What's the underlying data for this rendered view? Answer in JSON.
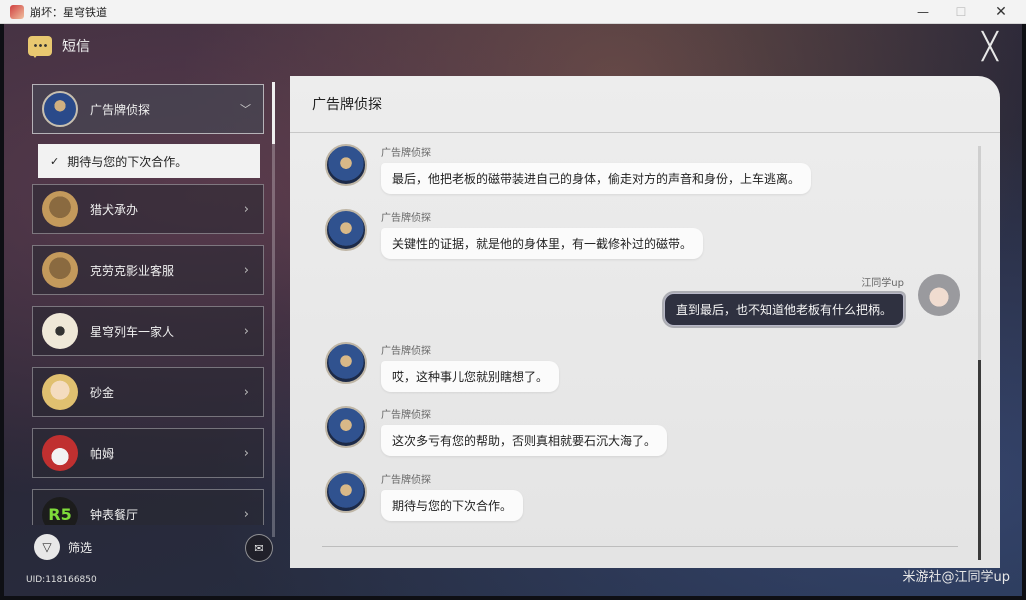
{
  "window": {
    "title": "崩坏：星穹铁道",
    "minimize": "—",
    "maximize": "☐",
    "close": "✕"
  },
  "header": {
    "title": "短信",
    "close_glyph": "╳"
  },
  "sidebar": {
    "contacts": [
      {
        "name": "广告牌侦探",
        "expanded": true
      },
      {
        "name": "猎犬承办"
      },
      {
        "name": "克劳克影业客服"
      },
      {
        "name": "星穹列车一家人"
      },
      {
        "name": "砂金"
      },
      {
        "name": "帕姆"
      },
      {
        "name": "钟表餐厅"
      }
    ],
    "sub_item": "期待与您的下次合作。",
    "filter_label": "筛选",
    "uid": "UID:118166850",
    "avatar_text_r5": "R5"
  },
  "chat": {
    "title": "广告牌侦探",
    "messages": [
      {
        "sender": "广告牌侦探",
        "text": "最后，他把老板的磁带装进自己的身体，偷走对方的声音和身份，上车逃离。",
        "side": "left"
      },
      {
        "sender": "广告牌侦探",
        "text": "关键性的证据，就是他的身体里，有一截修补过的磁带。",
        "side": "left"
      },
      {
        "sender": "江同学up",
        "text": "直到最后，也不知道他老板有什么把柄。",
        "side": "right"
      },
      {
        "sender": "广告牌侦探",
        "text": "哎，这种事儿您就别瞎想了。",
        "side": "left"
      },
      {
        "sender": "广告牌侦探",
        "text": "这次多亏有您的帮助，否则真相就要石沉大海了。",
        "side": "left"
      },
      {
        "sender": "广告牌侦探",
        "text": "期待与您的下次合作。",
        "side": "left"
      }
    ]
  },
  "watermark": "米游社@江同学up",
  "colors": {
    "panel": "#e8e8e8",
    "bubble": "#fbfbfb",
    "player_bubble": "#2f3140",
    "accent_icon": "#e8c870"
  }
}
